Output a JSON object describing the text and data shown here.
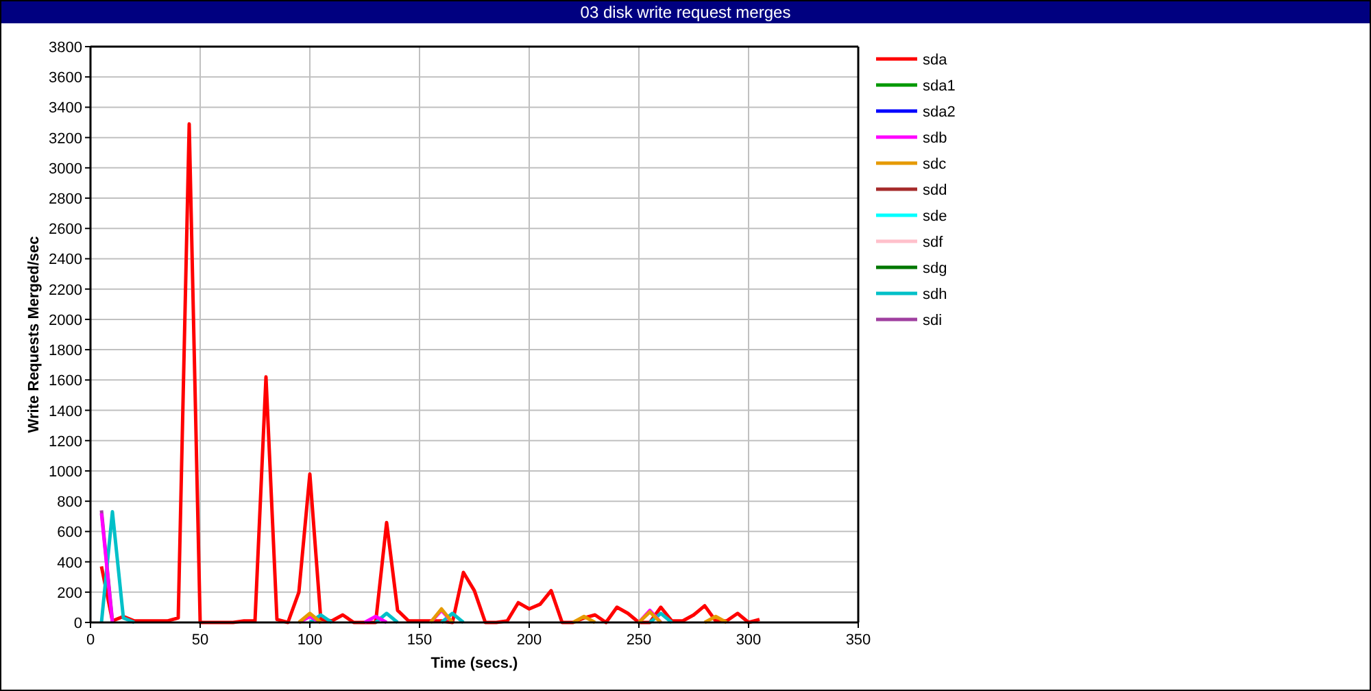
{
  "window": {
    "title": "03 disk write request merges"
  },
  "chart": {
    "chart_data": {
      "type": "line",
      "xlabel": "Time (secs.)",
      "ylabel": "Write Requests Merged/sec",
      "grid": true,
      "legend": true,
      "x": [
        5,
        10,
        15,
        20,
        25,
        30,
        35,
        40,
        45,
        50,
        55,
        60,
        65,
        70,
        75,
        80,
        85,
        90,
        95,
        100,
        105,
        110,
        115,
        120,
        125,
        130,
        135,
        140,
        145,
        150,
        155,
        160,
        165,
        170,
        175,
        180,
        185,
        190,
        195,
        200,
        205,
        210,
        215,
        220,
        225,
        230,
        235,
        240,
        245,
        250,
        255,
        260,
        265,
        270,
        275,
        280,
        285,
        290,
        295,
        300,
        305
      ],
      "xlim": [
        0,
        350
      ],
      "ylim": [
        0,
        3800
      ],
      "xticks": [
        0,
        50,
        100,
        150,
        200,
        250,
        300,
        350
      ],
      "yticks": [
        0,
        200,
        400,
        600,
        800,
        1000,
        1200,
        1400,
        1600,
        1800,
        2000,
        2200,
        2400,
        2600,
        2800,
        3000,
        3200,
        3400,
        3600,
        3800
      ],
      "series": [
        {
          "name": "sda",
          "color": "#ff0000",
          "values": [
            370,
            10,
            40,
            10,
            10,
            10,
            10,
            30,
            3290,
            0,
            0,
            0,
            0,
            10,
            10,
            1620,
            20,
            0,
            200,
            980,
            20,
            10,
            50,
            0,
            0,
            0,
            660,
            80,
            10,
            10,
            10,
            10,
            0,
            330,
            210,
            0,
            0,
            10,
            130,
            90,
            120,
            210,
            0,
            0,
            30,
            50,
            0,
            100,
            60,
            0,
            0,
            100,
            10,
            10,
            50,
            110,
            10,
            10,
            60,
            0,
            20
          ]
        },
        {
          "name": "sda1",
          "color": "#009900",
          "values": [
            null,
            null,
            null,
            null,
            null,
            null,
            null,
            null,
            null,
            null,
            null,
            null,
            null,
            null,
            null,
            null,
            null,
            null,
            null,
            null,
            null,
            null,
            null,
            null,
            null,
            null,
            null,
            null,
            null,
            null,
            null,
            null,
            null,
            null,
            null,
            null,
            null,
            null,
            null,
            null,
            null,
            null,
            null,
            null,
            null,
            null,
            null,
            null,
            null,
            null,
            null,
            null,
            null,
            null,
            null,
            null,
            null,
            null,
            null,
            null,
            null
          ]
        },
        {
          "name": "sda2",
          "color": "#0000ff",
          "values": [
            null,
            null,
            null,
            null,
            null,
            null,
            null,
            null,
            null,
            null,
            null,
            null,
            null,
            null,
            null,
            null,
            null,
            null,
            null,
            null,
            null,
            null,
            null,
            null,
            null,
            null,
            null,
            null,
            null,
            null,
            null,
            null,
            null,
            null,
            null,
            null,
            null,
            null,
            null,
            null,
            null,
            null,
            null,
            null,
            null,
            null,
            null,
            null,
            null,
            null,
            null,
            null,
            null,
            null,
            null,
            null,
            null,
            null,
            null,
            null,
            null
          ]
        },
        {
          "name": "sdb",
          "color": "#ff00ff",
          "values": [
            720,
            0,
            null,
            null,
            null,
            null,
            null,
            null,
            null,
            null,
            null,
            null,
            null,
            null,
            null,
            null,
            null,
            null,
            0,
            40,
            0,
            null,
            null,
            null,
            0,
            40,
            0,
            null,
            null,
            null,
            0,
            80,
            0,
            null,
            null,
            null,
            null,
            null,
            null,
            null,
            null,
            null,
            null,
            null,
            null,
            null,
            null,
            null,
            null,
            0,
            80,
            0,
            null,
            null,
            null,
            null,
            null,
            null,
            null,
            null,
            null
          ]
        },
        {
          "name": "sdc",
          "color": "#e69a00",
          "values": [
            null,
            null,
            null,
            null,
            null,
            null,
            null,
            null,
            null,
            null,
            null,
            null,
            null,
            null,
            null,
            null,
            null,
            null,
            0,
            60,
            0,
            null,
            null,
            null,
            null,
            null,
            null,
            null,
            null,
            null,
            0,
            90,
            0,
            null,
            null,
            null,
            null,
            null,
            null,
            null,
            null,
            null,
            null,
            0,
            40,
            0,
            null,
            null,
            null,
            0,
            70,
            0,
            null,
            null,
            null,
            0,
            40,
            0,
            null,
            null,
            null
          ]
        },
        {
          "name": "sdd",
          "color": "#a52a2a",
          "values": [
            null,
            null,
            null,
            null,
            null,
            null,
            null,
            null,
            null,
            null,
            null,
            null,
            null,
            null,
            null,
            null,
            null,
            null,
            null,
            null,
            null,
            null,
            null,
            null,
            null,
            null,
            null,
            null,
            null,
            null,
            null,
            null,
            null,
            null,
            null,
            null,
            null,
            null,
            null,
            null,
            null,
            null,
            null,
            null,
            null,
            null,
            null,
            null,
            null,
            null,
            null,
            null,
            null,
            null,
            null,
            null,
            null,
            null,
            null,
            null,
            null
          ]
        },
        {
          "name": "sde",
          "color": "#00ffff",
          "values": [
            null,
            null,
            null,
            null,
            null,
            null,
            null,
            null,
            null,
            null,
            null,
            null,
            null,
            null,
            null,
            null,
            null,
            null,
            null,
            null,
            null,
            null,
            null,
            null,
            null,
            null,
            null,
            null,
            null,
            null,
            null,
            null,
            null,
            null,
            null,
            null,
            null,
            null,
            null,
            null,
            null,
            null,
            null,
            null,
            null,
            null,
            null,
            null,
            null,
            null,
            null,
            null,
            null,
            null,
            null,
            null,
            null,
            null,
            null,
            null,
            null
          ]
        },
        {
          "name": "sdf",
          "color": "#ffc0cb",
          "values": [
            null,
            null,
            null,
            null,
            null,
            null,
            null,
            null,
            null,
            null,
            null,
            null,
            null,
            null,
            null,
            null,
            null,
            null,
            null,
            null,
            null,
            null,
            null,
            null,
            null,
            null,
            null,
            null,
            null,
            null,
            null,
            null,
            null,
            null,
            null,
            null,
            null,
            null,
            null,
            null,
            null,
            null,
            null,
            null,
            null,
            null,
            null,
            null,
            null,
            null,
            null,
            null,
            null,
            null,
            null,
            null,
            null,
            null,
            null,
            null,
            null
          ]
        },
        {
          "name": "sdg",
          "color": "#007700",
          "values": [
            null,
            null,
            null,
            null,
            null,
            null,
            null,
            null,
            null,
            null,
            null,
            null,
            null,
            null,
            null,
            null,
            null,
            null,
            null,
            null,
            null,
            null,
            null,
            null,
            null,
            null,
            null,
            null,
            null,
            null,
            null,
            null,
            null,
            null,
            null,
            null,
            null,
            null,
            null,
            null,
            null,
            null,
            null,
            null,
            null,
            null,
            null,
            null,
            null,
            null,
            null,
            null,
            null,
            null,
            null,
            null,
            null,
            null,
            null,
            null,
            null
          ]
        },
        {
          "name": "sdh",
          "color": "#00c0c8",
          "values": [
            0,
            730,
            30,
            0,
            null,
            null,
            null,
            null,
            null,
            null,
            null,
            null,
            null,
            null,
            null,
            null,
            null,
            null,
            null,
            0,
            50,
            0,
            null,
            null,
            null,
            0,
            60,
            0,
            null,
            null,
            null,
            0,
            60,
            0,
            null,
            null,
            null,
            null,
            null,
            null,
            null,
            null,
            null,
            null,
            null,
            null,
            null,
            null,
            null,
            null,
            0,
            60,
            0,
            null,
            null,
            null,
            null,
            null,
            null,
            null,
            null
          ]
        },
        {
          "name": "sdi",
          "color": "#a040a0",
          "values": [
            740,
            10,
            null,
            null,
            null,
            null,
            null,
            null,
            null,
            null,
            null,
            null,
            null,
            null,
            null,
            null,
            null,
            null,
            null,
            null,
            null,
            null,
            null,
            null,
            null,
            null,
            null,
            null,
            null,
            null,
            null,
            null,
            null,
            null,
            null,
            null,
            null,
            null,
            null,
            null,
            null,
            null,
            null,
            null,
            null,
            null,
            null,
            null,
            null,
            null,
            null,
            null,
            null,
            null,
            null,
            null,
            null,
            null,
            null,
            null,
            null
          ]
        }
      ]
    }
  }
}
